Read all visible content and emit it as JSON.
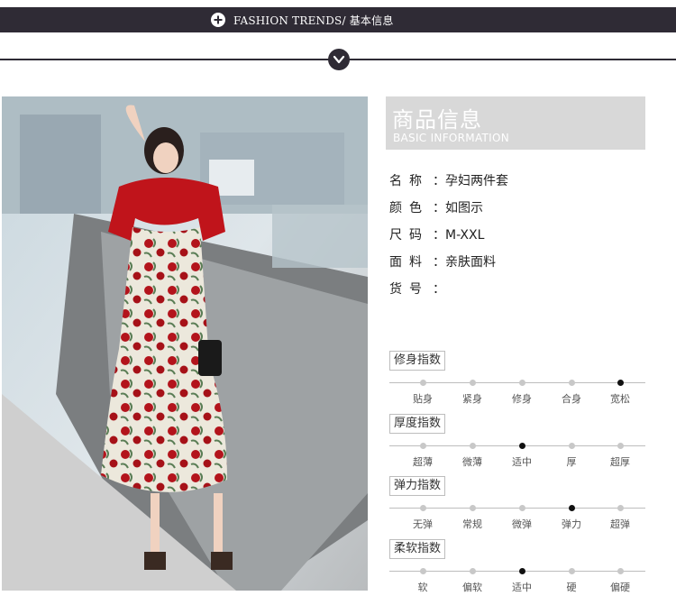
{
  "banner": {
    "title": "FASHION TRENDS/ 基本信息",
    "icon": "plus-circle-icon"
  },
  "divider": {
    "icon": "chevron-down-icon"
  },
  "photo": {
    "alt": "model-photo"
  },
  "info": {
    "title_zh": "商品信息",
    "title_en": "BASIC INFORMATION",
    "attributes": [
      {
        "key": "名称",
        "value": "孕妇两件套"
      },
      {
        "key": "颜色",
        "value": "如图示"
      },
      {
        "key": "尺码",
        "value": "M-XXL"
      },
      {
        "key": "面料",
        "value": "亲肤面料"
      },
      {
        "key": "货号",
        "value": ""
      }
    ]
  },
  "scales": [
    {
      "label": "修身指数",
      "options": [
        "贴身",
        "紧身",
        "修身",
        "合身",
        "宽松"
      ],
      "selected": 4
    },
    {
      "label": "厚度指数",
      "options": [
        "超薄",
        "微薄",
        "适中",
        "厚",
        "超厚"
      ],
      "selected": 2
    },
    {
      "label": "弹力指数",
      "options": [
        "无弹",
        "常规",
        "微弹",
        "弹力",
        "超弹"
      ],
      "selected": 3
    },
    {
      "label": "柔软指数",
      "options": [
        "软",
        "偏软",
        "适中",
        "硬",
        "偏硬"
      ],
      "selected": 2
    }
  ],
  "colors": {
    "banner": "#2f2b35",
    "dot_active": "#111111",
    "dot_inactive": "#c8c8c8",
    "header_bg": "#d8d8d8"
  }
}
